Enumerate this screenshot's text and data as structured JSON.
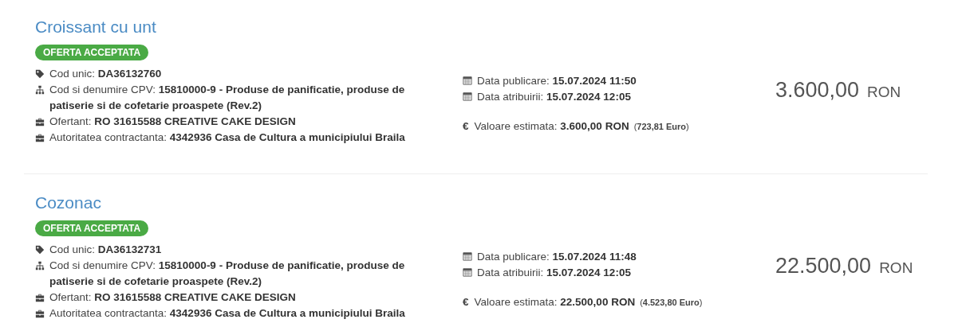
{
  "results": [
    {
      "title": "Croissant cu unt",
      "status": "OFERTA ACCEPTATA",
      "fields": [
        {
          "kind": "tag",
          "label": "Cod unic:",
          "value": "DA36132760"
        },
        {
          "kind": "cpv",
          "label": "Cod si denumire CPV:",
          "value": "15810000-9 - Produse de panificatie, produse de patiserie si de cofetarie proaspete (Rev.2)"
        },
        {
          "kind": "party",
          "label": "Ofertant:",
          "value": "RO 31615588 CREATIVE CAKE DESIGN"
        },
        {
          "kind": "party",
          "label": "Autoritatea contractanta:",
          "value": "4342936 Casa de Cultura a municipiului Braila"
        }
      ],
      "dates": [
        {
          "label": "Data publicare:",
          "value": "15.07.2024 11:50"
        },
        {
          "label": "Data atribuirii:",
          "value": "15.07.2024 12:05"
        }
      ],
      "estimate": {
        "symbol": "€",
        "label": "Valoare estimata:",
        "value": "3.600,00  RON",
        "euro": "(**723,81  Euro**)"
      },
      "price": {
        "amount": "3.600,00",
        "currency": "RON"
      }
    },
    {
      "title": "Cozonac",
      "status": "OFERTA ACCEPTATA",
      "fields": [
        {
          "kind": "tag",
          "label": "Cod unic:",
          "value": "DA36132731"
        },
        {
          "kind": "cpv",
          "label": "Cod si denumire CPV:",
          "value": "15810000-9 - Produse de panificatie, produse de patiserie si de cofetarie proaspete (Rev.2)"
        },
        {
          "kind": "party",
          "label": "Ofertant:",
          "value": "RO 31615588 CREATIVE CAKE DESIGN"
        },
        {
          "kind": "party",
          "label": "Autoritatea contractanta:",
          "value": "4342936 Casa de Cultura a municipiului Braila"
        }
      ],
      "dates": [
        {
          "label": "Data publicare:",
          "value": "15.07.2024 11:48"
        },
        {
          "label": "Data atribuirii:",
          "value": "15.07.2024 12:05"
        }
      ],
      "estimate": {
        "symbol": "€",
        "label": "Valoare estimata:",
        "value": "22.500,00  RON",
        "euro": "(**4.523,80  Euro**)"
      },
      "price": {
        "amount": "22.500,00",
        "currency": "RON"
      }
    }
  ]
}
